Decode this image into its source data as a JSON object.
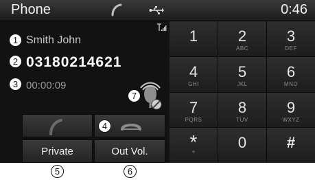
{
  "status_bar": {
    "title": "Phone",
    "time": "0:46",
    "icons": [
      "handset-icon",
      "usb-icon"
    ]
  },
  "call": {
    "name": "Smith John",
    "number": "03180214621",
    "duration": "00:00:09"
  },
  "buttons": {
    "private_label": "Private",
    "out_vol_label": "Out Vol."
  },
  "callouts": [
    "1",
    "2",
    "3",
    "4",
    "5",
    "6",
    "7"
  ],
  "keypad": [
    {
      "digit": "1",
      "letters": ""
    },
    {
      "digit": "2",
      "letters": "ABC"
    },
    {
      "digit": "3",
      "letters": "DEF"
    },
    {
      "digit": "4",
      "letters": "GHI"
    },
    {
      "digit": "5",
      "letters": "JKL"
    },
    {
      "digit": "6",
      "letters": "MNO"
    },
    {
      "digit": "7",
      "letters": "PQRS"
    },
    {
      "digit": "8",
      "letters": "TUV"
    },
    {
      "digit": "9",
      "letters": "WXYZ"
    },
    {
      "digit": "*",
      "letters": "+"
    },
    {
      "digit": "0",
      "letters": ""
    },
    {
      "digit": "#",
      "letters": ""
    }
  ],
  "colors": {
    "background": "#141414",
    "accept_green": "#6a6a6a",
    "end_red": "#8a8a8a"
  }
}
